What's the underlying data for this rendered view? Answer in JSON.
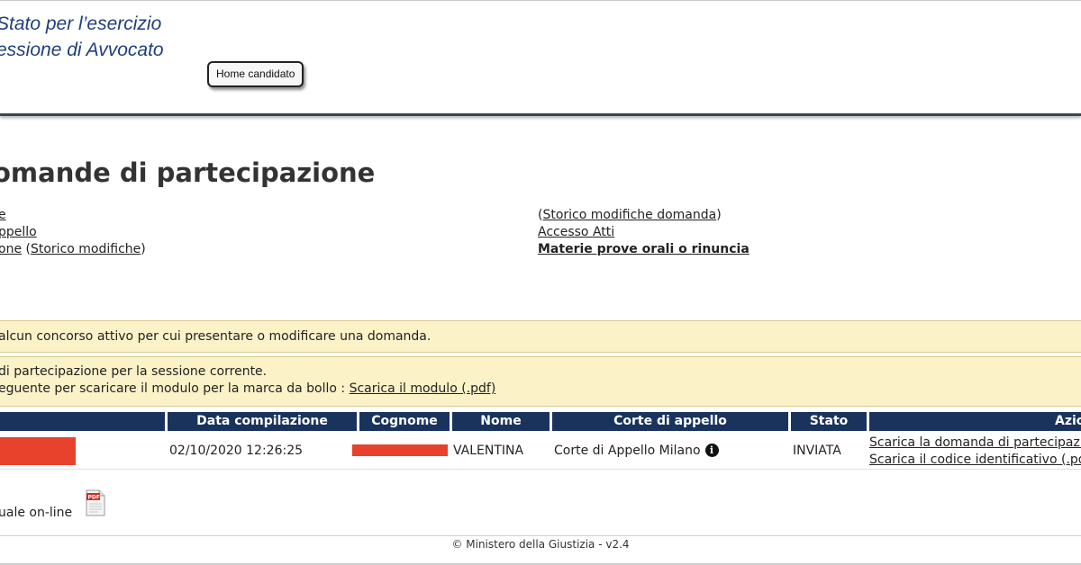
{
  "header": {
    "title_line1": "Stato per l’esercizio",
    "title_line2": "essione di Avvocato",
    "home_button": "Home candidato"
  },
  "page": {
    "title": "omande di partecipazione"
  },
  "links": {
    "left": {
      "item1": "e",
      "item2": "ppello",
      "item3_main": "one",
      "item3_paren_open": " (",
      "item3_paren_link": "Storico modifiche",
      "item3_paren_close": ")"
    },
    "right": {
      "storico_open": "(",
      "storico_link": "Storico modifiche domanda",
      "storico_close": ")",
      "accesso_atti": "Accesso Atti",
      "materie": "Materie prove orali o rinuncia"
    }
  },
  "notices": {
    "no_contest": "alcun concorso attivo per cui presentare o modificare una domanda.",
    "current_line1": "di partecipazione per la sessione corrente.",
    "current_line2": "eguente per scaricare il modulo per la marca da bollo : ",
    "download_link": "Scarica il modulo (.pdf)"
  },
  "table": {
    "headers": {
      "data": "Data compilazione",
      "cognome": "Cognome",
      "nome": "Nome",
      "corte": "Corte di appello",
      "stato": "Stato",
      "azioni": "Azioni"
    },
    "row": {
      "data": "02/10/2020 12:26:25",
      "nome": "VALENTINA",
      "corte": "Corte di Appello Milano",
      "stato": "INVIATA",
      "action1": "Scarica la domanda di partecipazione",
      "action2": "Scarica il codice identificativo (.pdf)"
    }
  },
  "manual": {
    "text": "uale on-line",
    "icon_label": "PDF"
  },
  "footer": {
    "text": "© Ministero della Giustizia  - v2.4"
  },
  "colors": {
    "header_text": "#1f3f7a",
    "table_header_bg": "#19335c",
    "notice_bg": "#fbf2c8",
    "redaction": "#e8412c"
  }
}
